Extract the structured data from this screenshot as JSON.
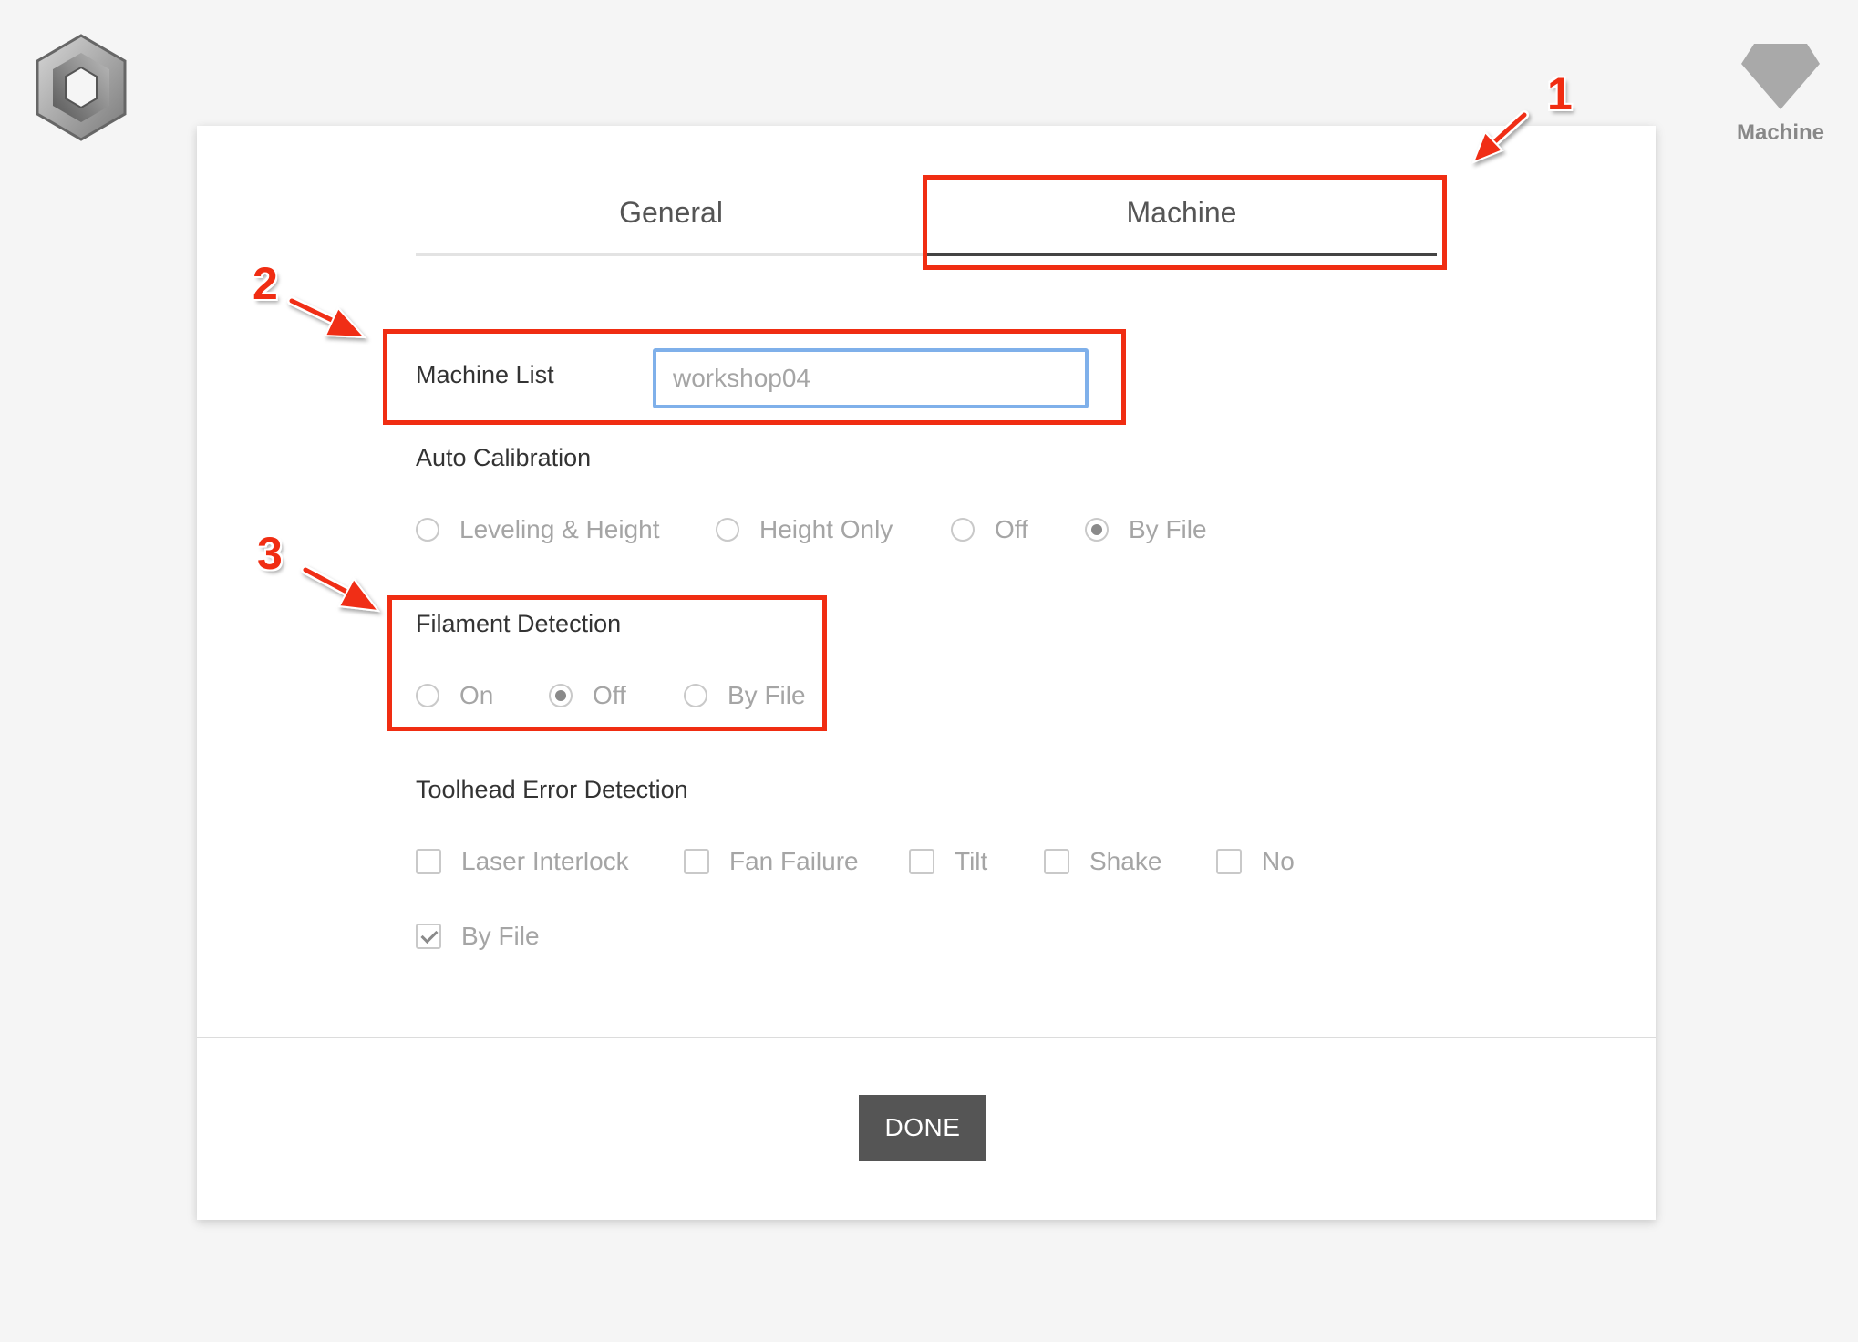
{
  "header": {
    "machine_indicator_label": "Machine"
  },
  "tabs": [
    {
      "label": "General",
      "active": false
    },
    {
      "label": "Machine",
      "active": true
    }
  ],
  "machine_list": {
    "label": "Machine List",
    "value": "",
    "placeholder": "workshop04"
  },
  "auto_calibration": {
    "label": "Auto Calibration",
    "options": [
      {
        "label": "Leveling & Height",
        "checked": false
      },
      {
        "label": "Height Only",
        "checked": false
      },
      {
        "label": "Off",
        "checked": false
      },
      {
        "label": "By File",
        "checked": true
      }
    ]
  },
  "filament_detection": {
    "label": "Filament Detection",
    "options": [
      {
        "label": "On",
        "checked": false
      },
      {
        "label": "Off",
        "checked": true
      },
      {
        "label": "By File",
        "checked": false
      }
    ]
  },
  "toolhead_error_detection": {
    "label": "Toolhead Error Detection",
    "options": [
      {
        "label": "Laser Interlock",
        "checked": false
      },
      {
        "label": "Fan Failure",
        "checked": false
      },
      {
        "label": "Tilt",
        "checked": false
      },
      {
        "label": "Shake",
        "checked": false
      },
      {
        "label": "No",
        "checked": false
      },
      {
        "label": "By File",
        "checked": true
      }
    ]
  },
  "footer": {
    "done_label": "DONE"
  },
  "annotations": [
    {
      "number": "1"
    },
    {
      "number": "2"
    },
    {
      "number": "3"
    }
  ],
  "colors": {
    "annotation_red": "#f02d12",
    "input_focus_border": "#7fb0ea",
    "done_button_bg": "#555555",
    "page_background": "#f5f5f5"
  },
  "icons": {
    "app_logo": "hexagon-logo-icon",
    "machine_indicator": "gem-icon"
  }
}
